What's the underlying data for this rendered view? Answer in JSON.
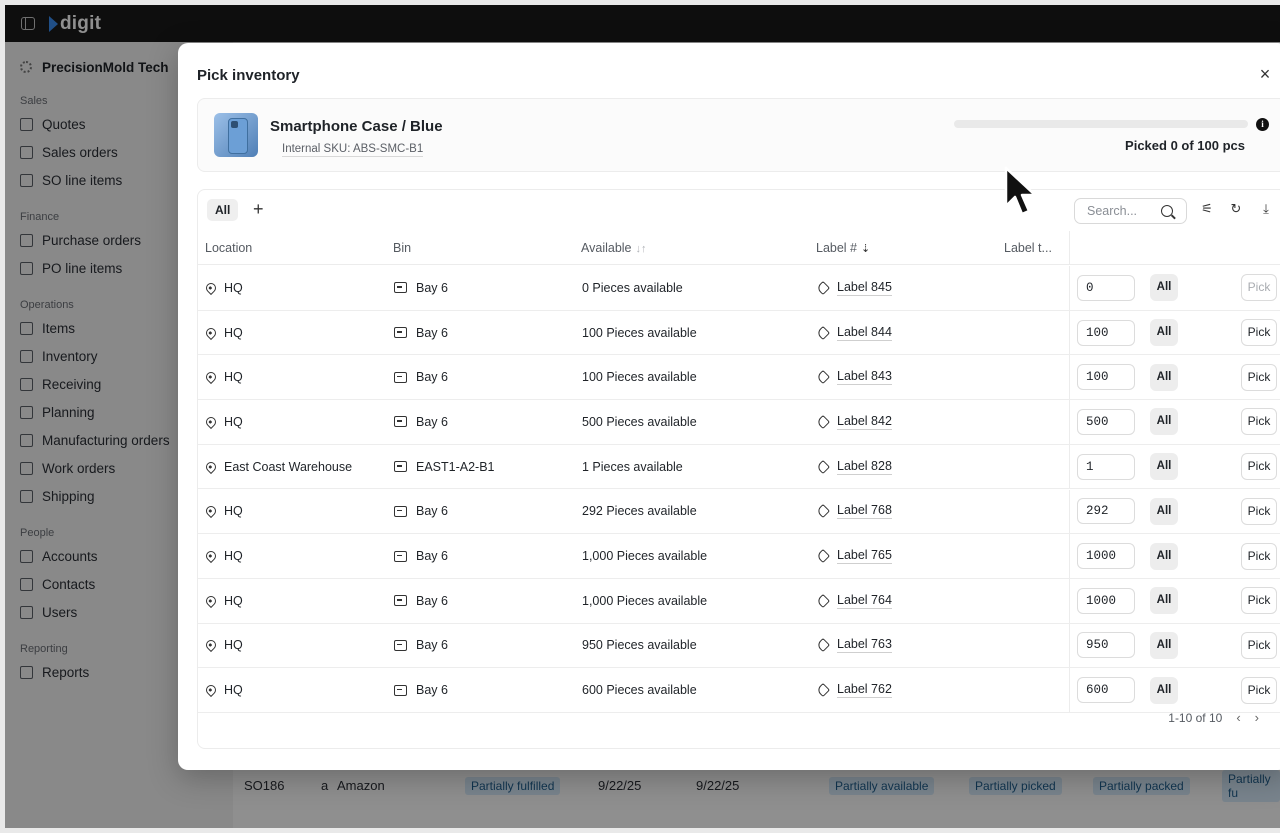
{
  "app": {
    "logo": "digit",
    "org": "PrecisionMold Tech"
  },
  "sidebar": {
    "sections": [
      {
        "title": "Sales",
        "items": [
          "Quotes",
          "Sales orders",
          "SO line items"
        ]
      },
      {
        "title": "Finance",
        "items": [
          "Purchase orders",
          "PO line items"
        ]
      },
      {
        "title": "Operations",
        "items": [
          "Items",
          "Inventory",
          "Receiving",
          "Planning",
          "Manufacturing orders",
          "Work orders",
          "Shipping"
        ]
      },
      {
        "title": "People",
        "items": [
          "Accounts",
          "Contacts",
          "Users"
        ]
      },
      {
        "title": "Reporting",
        "items": [
          "Reports"
        ]
      }
    ]
  },
  "background_row": {
    "order": "SO186",
    "customer": "Amazon",
    "status": "Partially fulfilled",
    "date1": "9/22/25",
    "date2": "9/22/25",
    "availability": "Partially available",
    "picked": "Partially picked",
    "packed": "Partially packed",
    "fulfilled": "Partially fu"
  },
  "modal": {
    "title": "Pick inventory",
    "close": "×",
    "product": {
      "name": "Smartphone Case / Blue",
      "sku": "Internal SKU: ABS-SMC-B1",
      "picked_text": "Picked 0 of 100 pcs",
      "picked_fraction": 0,
      "info": "i"
    },
    "toolbar": {
      "tab_all": "All",
      "add": "+",
      "search_placeholder": "Search..."
    },
    "columns": {
      "location": "Location",
      "bin": "Bin",
      "available": "Available",
      "label": "Label #",
      "label_type": "Label t..."
    },
    "all_label": "All",
    "pick_label": "Pick",
    "rows": [
      {
        "location": "HQ",
        "bin": "Bay 6",
        "available": "0 Pieces available",
        "label": "Label 845",
        "qty": "0",
        "pick_disabled": true
      },
      {
        "location": "HQ",
        "bin": "Bay 6",
        "available": "100 Pieces available",
        "label": "Label 844",
        "qty": "100",
        "pick_disabled": false
      },
      {
        "location": "HQ",
        "bin": "Bay 6",
        "available": "100 Pieces available",
        "label": "Label 843",
        "qty": "100",
        "pick_disabled": false
      },
      {
        "location": "HQ",
        "bin": "Bay 6",
        "available": "500 Pieces available",
        "label": "Label 842",
        "qty": "500",
        "pick_disabled": false
      },
      {
        "location": "East Coast Warehouse",
        "bin": "EAST1-A2-B1",
        "available": "1 Pieces available",
        "label": "Label 828",
        "qty": "1",
        "pick_disabled": false
      },
      {
        "location": "HQ",
        "bin": "Bay 6",
        "available": "292 Pieces available",
        "label": "Label 768",
        "qty": "292",
        "pick_disabled": false
      },
      {
        "location": "HQ",
        "bin": "Bay 6",
        "available": "1,000 Pieces available",
        "label": "Label 765",
        "qty": "1000",
        "pick_disabled": false
      },
      {
        "location": "HQ",
        "bin": "Bay 6",
        "available": "1,000 Pieces available",
        "label": "Label 764",
        "qty": "1000",
        "pick_disabled": false
      },
      {
        "location": "HQ",
        "bin": "Bay 6",
        "available": "950 Pieces available",
        "label": "Label 763",
        "qty": "950",
        "pick_disabled": false
      },
      {
        "location": "HQ",
        "bin": "Bay 6",
        "available": "600 Pieces available",
        "label": "Label 762",
        "qty": "600",
        "pick_disabled": false
      }
    ],
    "pagination": {
      "range": "1-10 of 10",
      "prev": "‹",
      "next": "›"
    }
  },
  "colors": {
    "topbar": "#1a1a1a",
    "logo_mark": "#3a8df0",
    "badge_bg": "#d8ecfb"
  }
}
